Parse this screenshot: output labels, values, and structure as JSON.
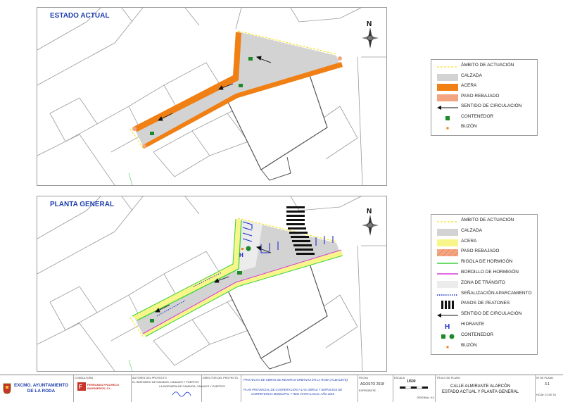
{
  "panels": {
    "estado": {
      "title": "ESTADO ACTUAL"
    },
    "planta": {
      "title": "PLANTA GENERAL"
    }
  },
  "north_label": "N",
  "legend_estado": [
    {
      "label": "ÁMBITO DE ACTUACIÓN",
      "symbol": "dashed-yellow-line",
      "color": "#f5e22b"
    },
    {
      "label": "CALZADA",
      "symbol": "fill",
      "color": "#d3d3d3"
    },
    {
      "label": "ACERA",
      "symbol": "fill",
      "color": "#f07f14"
    },
    {
      "label": "PASO REBAJADO",
      "symbol": "fill",
      "color": "#f3a480"
    },
    {
      "label": "SENTIDO DE CIRCULACIÓN",
      "symbol": "arrow",
      "color": "#111111"
    },
    {
      "label": "CONTENEDOR",
      "symbol": "green-square",
      "color": "#1c8a2a"
    },
    {
      "label": "BUZÓN",
      "symbol": "orange-dot",
      "color": "#f07f14"
    }
  ],
  "legend_planta": [
    {
      "label": "ÁMBITO DE ACTUACIÓN",
      "symbol": "dashed-yellow-line",
      "color": "#f5e22b"
    },
    {
      "label": "CALZADA",
      "symbol": "fill",
      "color": "#d3d3d3"
    },
    {
      "label": "ACERA",
      "symbol": "fill",
      "color": "#f8f68a"
    },
    {
      "label": "PASO REBAJADO",
      "symbol": "hatch",
      "color": "#f3a480"
    },
    {
      "label": "RIGOLA DE HORMIGÓN",
      "symbol": "line",
      "color": "#3cd23c"
    },
    {
      "label": "BORDILLO DE HORMIGÓN",
      "symbol": "line",
      "color": "#d63cd6"
    },
    {
      "label": "ZONA DE TRÁNSITO",
      "symbol": "fill",
      "color": "#ececec"
    },
    {
      "label": "SEÑALIZACIÓN APARCAMIENTO",
      "symbol": "dotted-blue-line",
      "color": "#1a2ec8"
    },
    {
      "label": "PASOS DE PEATONES",
      "symbol": "zebra",
      "color": "#111111"
    },
    {
      "label": "SENTIDO DE CIRCULACIÓN",
      "symbol": "arrow",
      "color": "#111111"
    },
    {
      "label": "HIDRANTE",
      "symbol": "hydrant",
      "color": "#1a2ec8"
    },
    {
      "label": "CONTENEDOR",
      "symbol": "green-square-circle",
      "color": "#1c8a2a"
    },
    {
      "label": "BUZÓN",
      "symbol": "orange-dot",
      "color": "#f07f14"
    }
  ],
  "cartouche": {
    "entity": "EXCMO. AYUNTAMIENTO\nDE LA RODA",
    "consultora_head": "CONSULTORA",
    "consultora_name": "FERRANDIZ+PACHECO\nINGENIEROS, S.L.",
    "autores_head": "AUTORES DEL PROYECTO",
    "autores_text": "EL INGENIERO DE CAMINOS, CANALES Y PUERTOS",
    "ingeniera_text": "LA INGENIERA DE CAMINOS, CANALES Y PUERTOS",
    "director_head": "DIRECTOR DEL PROYECTO",
    "project_title": "PROYECTO DE OBRAS DE MEJORAS URBANAS EN LA RODA (ALBACETE)",
    "plan_text": "PLAN PROVINCIAL DE COOPERACIÓN A LAS OBRAS Y SERVICIOS DE\nCOMPETENCIA MUNICIPAL Y RED VIARIA LOCAL AÑO 2018",
    "fecha_head": "FECHA",
    "fecha": "AGOSTO 2018",
    "expediente_head": "EXPEDIENTE",
    "escala_head": "ESCALA",
    "escala": "1/500",
    "original": "ORIGINAL: A3",
    "titulo_head": "TÍTULO DE PLANO",
    "plano_title": "CALLE ALMIRANTE ALARCÓN\nESTADO ACTUAL Y PLANTA GENERAL",
    "numero_head": "Nº DE PLANO",
    "numero": "3.1",
    "hoja": "HOJA: 01 DE 01"
  },
  "colors": {
    "accent_title": "#1f3fb0",
    "calzada": "#d3d3d3",
    "acera_estado": "#f07f14",
    "acera_planta": "#f8f68a",
    "contenedor": "#1c8a2a"
  }
}
